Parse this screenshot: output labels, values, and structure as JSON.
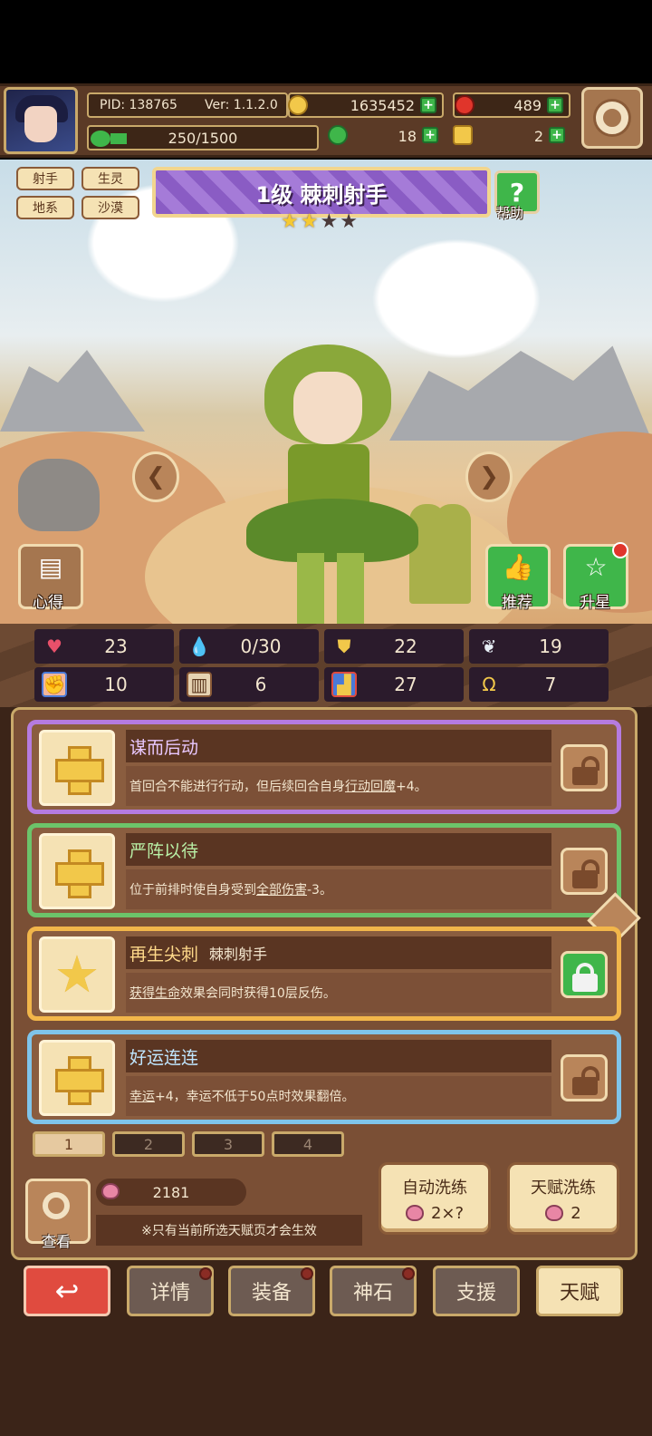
{
  "header": {
    "pid": "PID: 138765",
    "version": "Ver: 1.1.2.0",
    "gold": "1635452",
    "gems": "489",
    "stamina": "250/1500",
    "clover": "18",
    "keys": "2",
    "settings_icon": "gear-icon"
  },
  "hero": {
    "tags": [
      "射手",
      "生灵",
      "地系",
      "沙漠"
    ],
    "title": "1级 棘刺射手",
    "stars_filled": 2,
    "stars_total": 4,
    "help_label": "帮助",
    "left_button_label": "心得",
    "recommend_label": "推荐",
    "upgrade_star_label": "升星"
  },
  "stats": [
    {
      "icon": "heart-icon",
      "value": "23",
      "color": "#e8506a"
    },
    {
      "icon": "droplet-icon",
      "value": "0/30",
      "color": "#5fc6ea"
    },
    {
      "icon": "shield-icon",
      "value": "22",
      "color": "#f2c84a"
    },
    {
      "icon": "wing-icon",
      "value": "19",
      "color": "#e6eef5"
    },
    {
      "icon": "fist-icon",
      "value": "10",
      "color": "#f2b69a"
    },
    {
      "icon": "book-icon",
      "value": "6",
      "color": "#e6d3b3"
    },
    {
      "icon": "boot-icon",
      "value": "27",
      "color": "#4a7ad8"
    },
    {
      "icon": "horseshoe-icon",
      "value": "7",
      "color": "#f2c84a"
    }
  ],
  "talents": [
    {
      "title": "谋而后动",
      "sub": "",
      "desc_pre": "首回合不能进行行动，但后续回合自身",
      "desc_link": "行动回魔",
      "desc_post": "+4。",
      "border": "#b57be0",
      "title_color": "#e9c8ff",
      "icon": "cross-icon",
      "locked": true
    },
    {
      "title": "严阵以待",
      "sub": "",
      "desc_pre": "位于前排时使自身受到",
      "desc_link": "全部伤害",
      "desc_post": "-3。",
      "border": "#6cc46a",
      "title_color": "#b9f0a6",
      "icon": "cross-icon",
      "locked": true
    },
    {
      "title": "再生尖刺",
      "sub": "棘刺射手",
      "desc_pre": "",
      "desc_link": "获得生命",
      "desc_post": "效果会同时获得10层反伤。",
      "border": "#f2b64a",
      "title_color": "#ffd98a",
      "icon": "star-icon",
      "locked": false
    },
    {
      "title": "好运连连",
      "sub": "",
      "desc_pre": "",
      "desc_link": "幸运",
      "desc_post": "+4，幸运不低于50点时效果翻倍。",
      "border": "#7fc4ea",
      "title_color": "#bfe6ff",
      "icon": "cross-icon",
      "locked": true
    }
  ],
  "pages": [
    "1",
    "2",
    "3",
    "4"
  ],
  "active_page": "1",
  "view_label": "查看",
  "essence": "2181",
  "note": "※只有当前所选天赋页才会生效",
  "auto_refine": {
    "label": "自动洗练",
    "cost": "2×?"
  },
  "talent_refine": {
    "label": "天赋洗练",
    "cost": "2"
  },
  "nav": {
    "back_icon": "return-icon",
    "details": "详情",
    "equipment": "装备",
    "godstone": "神石",
    "support": "支援",
    "talent": "天赋"
  }
}
